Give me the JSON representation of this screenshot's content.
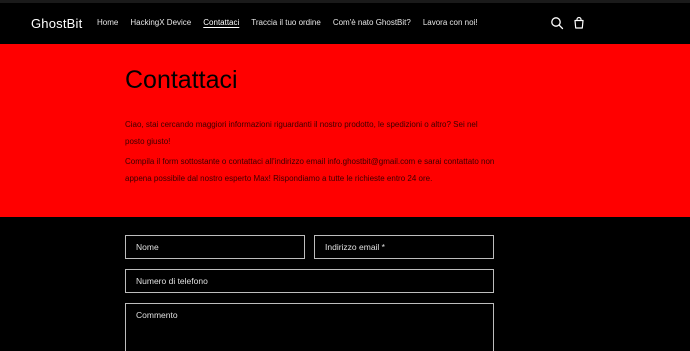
{
  "header": {
    "logo": "GhostBit",
    "nav": [
      {
        "label": "Home",
        "active": false
      },
      {
        "label": "HackingX Device",
        "active": false
      },
      {
        "label": "Contattaci",
        "active": true
      },
      {
        "label": "Traccia il tuo ordine",
        "active": false
      },
      {
        "label": "Com'è nato GhostBit?",
        "active": false
      },
      {
        "label": "Lavora con noi!",
        "active": false
      }
    ],
    "icons": [
      "search-icon",
      "cart-icon"
    ]
  },
  "hero": {
    "title": "Contattaci",
    "paragraph1": "Ciao, stai cercando maggiori informazioni riguardanti il nostro prodotto, le spedizioni o altro? Sei nel posto giusto!",
    "paragraph2": "Compila il form sottostante o contattaci all'indirizzo email info.ghostbit@gmail.com e sarai contattato non appena possibile dal nostro esperto Max! Rispondiamo a tutte le richieste entro 24 ore.",
    "background": "#ff0000"
  },
  "form": {
    "name_placeholder": "Nome",
    "email_placeholder": "Indirizzo email *",
    "phone_placeholder": "Numero di telefono",
    "comment_placeholder": "Commento"
  }
}
